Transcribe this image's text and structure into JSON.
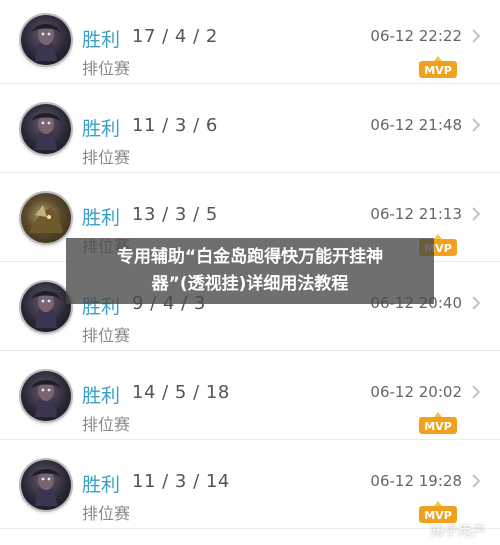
{
  "matches": [
    {
      "result": "胜利",
      "kda": "17 / 4 / 2",
      "mode": "排位赛",
      "time": "06-12 22:22",
      "mvp": true
    },
    {
      "result": "胜利",
      "kda": "11 / 3 / 6",
      "mode": "排位赛",
      "time": "06-12 21:48",
      "mvp": false
    },
    {
      "result": "胜利",
      "kda": "13 / 3 / 5",
      "mode": "排位赛",
      "time": "06-12 21:13",
      "mvp": true
    },
    {
      "result": "胜利",
      "kda": "9 / 4 / 3",
      "mode": "排位赛",
      "time": "06-12 20:40",
      "mvp": false
    },
    {
      "result": "胜利",
      "kda": "14 / 5 / 18",
      "mode": "排位赛",
      "time": "06-12 20:02",
      "mvp": true
    },
    {
      "result": "胜利",
      "kda": "11 / 3 / 14",
      "mode": "排位赛",
      "time": "06-12 19:28",
      "mvp": true
    }
  ],
  "mvp_badge": "MVP",
  "overlay": {
    "line1": "专用辅助“白金岛跑得快万能开挂神",
    "line2": "器”(透视挂)详细用法教程"
  },
  "watermark": "知乎用户",
  "colors": {
    "result": "#3aa0c8",
    "mvp": "#f0a21e"
  }
}
